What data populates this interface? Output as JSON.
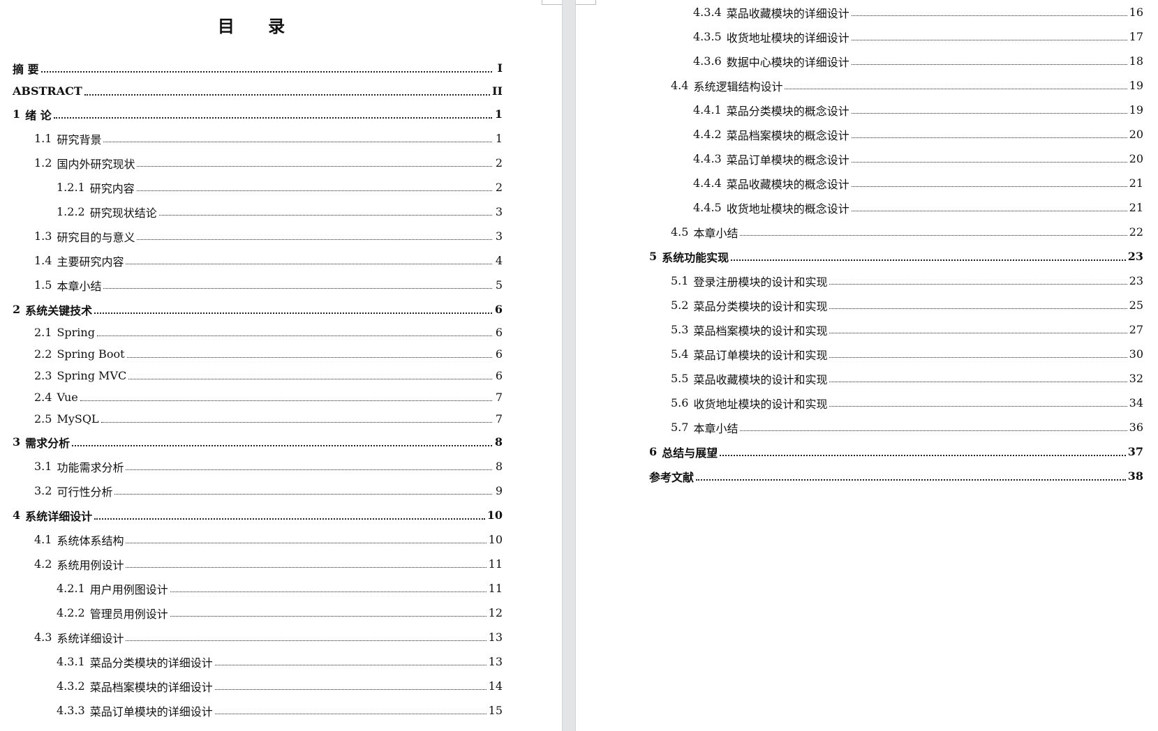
{
  "title": "目 录",
  "left": [
    {
      "num": "",
      "text": "摘  要",
      "page": "I",
      "level": 1
    },
    {
      "num": "",
      "text": "ABSTRACT",
      "page": "II",
      "level": 1,
      "en": true
    },
    {
      "num": "1",
      "text": "绪 论",
      "page": "1",
      "level": 1
    },
    {
      "num": "1.1",
      "text": "研究背景",
      "page": "1",
      "level": 2
    },
    {
      "num": "1.2",
      "text": "国内外研究现状",
      "page": "2",
      "level": 2
    },
    {
      "num": "1.2.1",
      "text": "研究内容",
      "page": "2",
      "level": 3
    },
    {
      "num": "1.2.2",
      "text": "研究现状结论",
      "page": "3",
      "level": 3
    },
    {
      "num": "1.3",
      "text": "研究目的与意义",
      "page": "3",
      "level": 2
    },
    {
      "num": "1.4",
      "text": "主要研究内容",
      "page": "4",
      "level": 2
    },
    {
      "num": "1.5",
      "text": "本章小结",
      "page": "5",
      "level": 2
    },
    {
      "num": "2",
      "text": "系统关键技术",
      "page": "6",
      "level": 1
    },
    {
      "num": "2.1",
      "text": "Spring",
      "page": "6",
      "level": 2,
      "en": true
    },
    {
      "num": "2.2",
      "text": "Spring Boot",
      "page": "6",
      "level": 2,
      "en": true
    },
    {
      "num": "2.3",
      "text": "Spring MVC",
      "page": "6",
      "level": 2,
      "en": true
    },
    {
      "num": "2.4",
      "text": "Vue",
      "page": "7",
      "level": 2,
      "en": true
    },
    {
      "num": "2.5",
      "text": "MySQL",
      "page": "7",
      "level": 2,
      "en": true
    },
    {
      "num": "3",
      "text": "需求分析",
      "page": "8",
      "level": 1
    },
    {
      "num": "3.1",
      "text": "功能需求分析",
      "page": "8",
      "level": 2
    },
    {
      "num": "3.2",
      "text": "可行性分析",
      "page": "9",
      "level": 2
    },
    {
      "num": "4",
      "text": "系统详细设计",
      "page": "10",
      "level": 1
    },
    {
      "num": "4.1",
      "text": "系统体系结构",
      "page": "10",
      "level": 2
    },
    {
      "num": "4.2",
      "text": "系统用例设计",
      "page": "11",
      "level": 2
    },
    {
      "num": "4.2.1",
      "text": "用户用例图设计",
      "page": "11",
      "level": 3
    },
    {
      "num": "4.2.2",
      "text": "管理员用例设计",
      "page": "12",
      "level": 3
    },
    {
      "num": "4.3",
      "text": "系统详细设计",
      "page": "13",
      "level": 2
    },
    {
      "num": "4.3.1",
      "text": "菜品分类模块的详细设计",
      "page": "13",
      "level": 3
    },
    {
      "num": "4.3.2",
      "text": "菜品档案模块的详细设计",
      "page": "14",
      "level": 3
    },
    {
      "num": "4.3.3",
      "text": "菜品订单模块的详细设计",
      "page": "15",
      "level": 3
    }
  ],
  "right": [
    {
      "num": "4.3.4",
      "text": "菜品收藏模块的详细设计",
      "page": "16",
      "level": 3
    },
    {
      "num": "4.3.5",
      "text": "收货地址模块的详细设计",
      "page": "17",
      "level": 3
    },
    {
      "num": "4.3.6",
      "text": "数据中心模块的详细设计",
      "page": "18",
      "level": 3
    },
    {
      "num": "4.4",
      "text": "系统逻辑结构设计",
      "page": "19",
      "level": 2
    },
    {
      "num": "4.4.1",
      "text": "菜品分类模块的概念设计",
      "page": "19",
      "level": 3
    },
    {
      "num": "4.4.2",
      "text": "菜品档案模块的概念设计",
      "page": "20",
      "level": 3
    },
    {
      "num": "4.4.3",
      "text": "菜品订单模块的概念设计",
      "page": "20",
      "level": 3
    },
    {
      "num": "4.4.4",
      "text": "菜品收藏模块的概念设计",
      "page": "21",
      "level": 3
    },
    {
      "num": "4.4.5",
      "text": "收货地址模块的概念设计",
      "page": "21",
      "level": 3
    },
    {
      "num": "4.5",
      "text": "本章小结",
      "page": "22",
      "level": 2
    },
    {
      "num": "5",
      "text": "系统功能实现",
      "page": "23",
      "level": 1
    },
    {
      "num": "5.1",
      "text": "登录注册模块的设计和实现",
      "page": "23",
      "level": 2
    },
    {
      "num": "5.2",
      "text": "菜品分类模块的设计和实现",
      "page": "25",
      "level": 2
    },
    {
      "num": "5.3",
      "text": "菜品档案模块的设计和实现",
      "page": "27",
      "level": 2
    },
    {
      "num": "5.4",
      "text": "菜品订单模块的设计和实现",
      "page": "30",
      "level": 2
    },
    {
      "num": "5.5",
      "text": "菜品收藏模块的设计和实现",
      "page": "32",
      "level": 2
    },
    {
      "num": "5.6",
      "text": "收货地址模块的设计和实现",
      "page": "34",
      "level": 2
    },
    {
      "num": "5.7",
      "text": "本章小结",
      "page": "36",
      "level": 2
    },
    {
      "num": "6",
      "text": "总结与展望",
      "page": "37",
      "level": 1
    },
    {
      "num": "",
      "text": "参考文献",
      "page": "38",
      "level": 1
    }
  ]
}
